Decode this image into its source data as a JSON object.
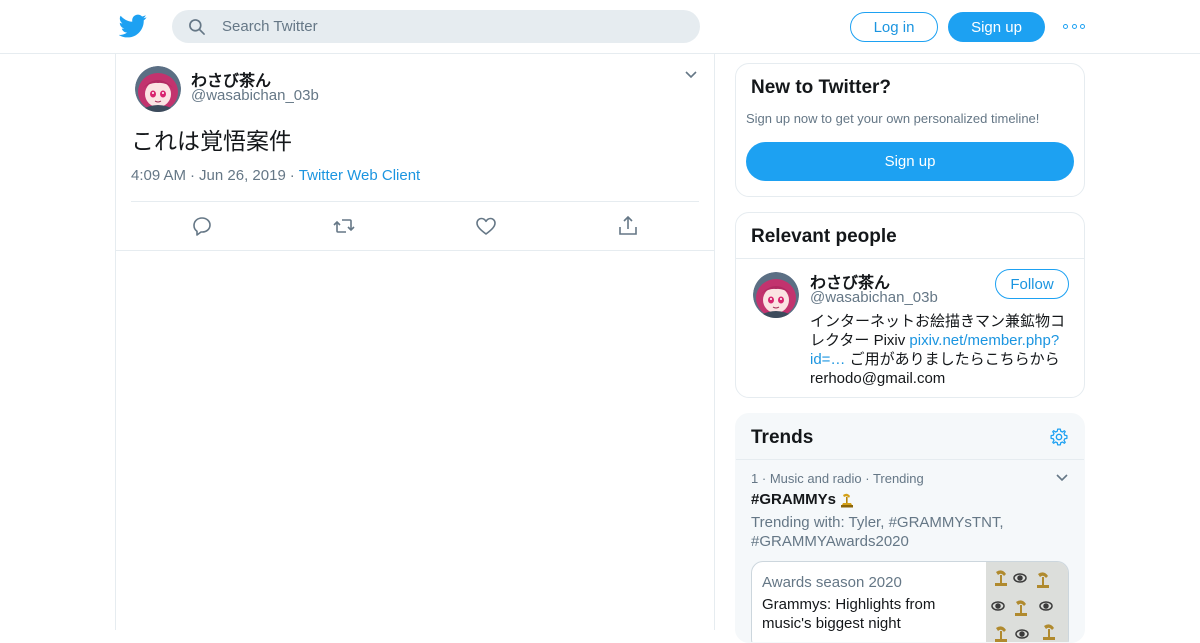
{
  "header": {
    "logo_icon": "twitter-bird-icon",
    "search_placeholder": "Search Twitter",
    "login_label": "Log in",
    "signup_label": "Sign up",
    "more_icon": "more-dots-icon",
    "brand_color": "#1da1f2"
  },
  "tweet": {
    "author_name": "わさび茶ん",
    "author_handle": "@wasabichan_03b",
    "text": "これは覚悟案件",
    "time": "4:09 AM",
    "date": "Jun 26, 2019",
    "client": "Twitter Web Client",
    "actions": [
      "reply-icon",
      "retweet-icon",
      "like-icon",
      "share-icon"
    ]
  },
  "new_to_twitter": {
    "title": "New to Twitter?",
    "subtitle": "Sign up now to get your own personalized timeline!",
    "button_label": "Sign up"
  },
  "relevant_people": {
    "title": "Relevant people",
    "name": "わさび茶ん",
    "handle": "@wasabichan_03b",
    "follow_label": "Follow",
    "bio_part1": "インターネットお絵描きマン兼鉱物コレクター Pixiv ",
    "bio_link": "pixiv.net/member.php?id=…",
    "bio_part2": " ご用がありましたらこちらから rerhodo@gmail.com"
  },
  "trends": {
    "title": "Trends",
    "settings_icon": "gear-icon",
    "item": {
      "rank": "1",
      "category": "Music and radio",
      "status": "Trending",
      "name": "#GRAMMYs",
      "emoji_icon": "grammy-trophy-icon",
      "trending_with": "Trending with: Tyler, #GRAMMYsTNT, #GRAMMYAwards2020",
      "card_kicker": "Awards season 2020",
      "card_headline": "Grammys: Highlights from music's biggest night"
    }
  }
}
